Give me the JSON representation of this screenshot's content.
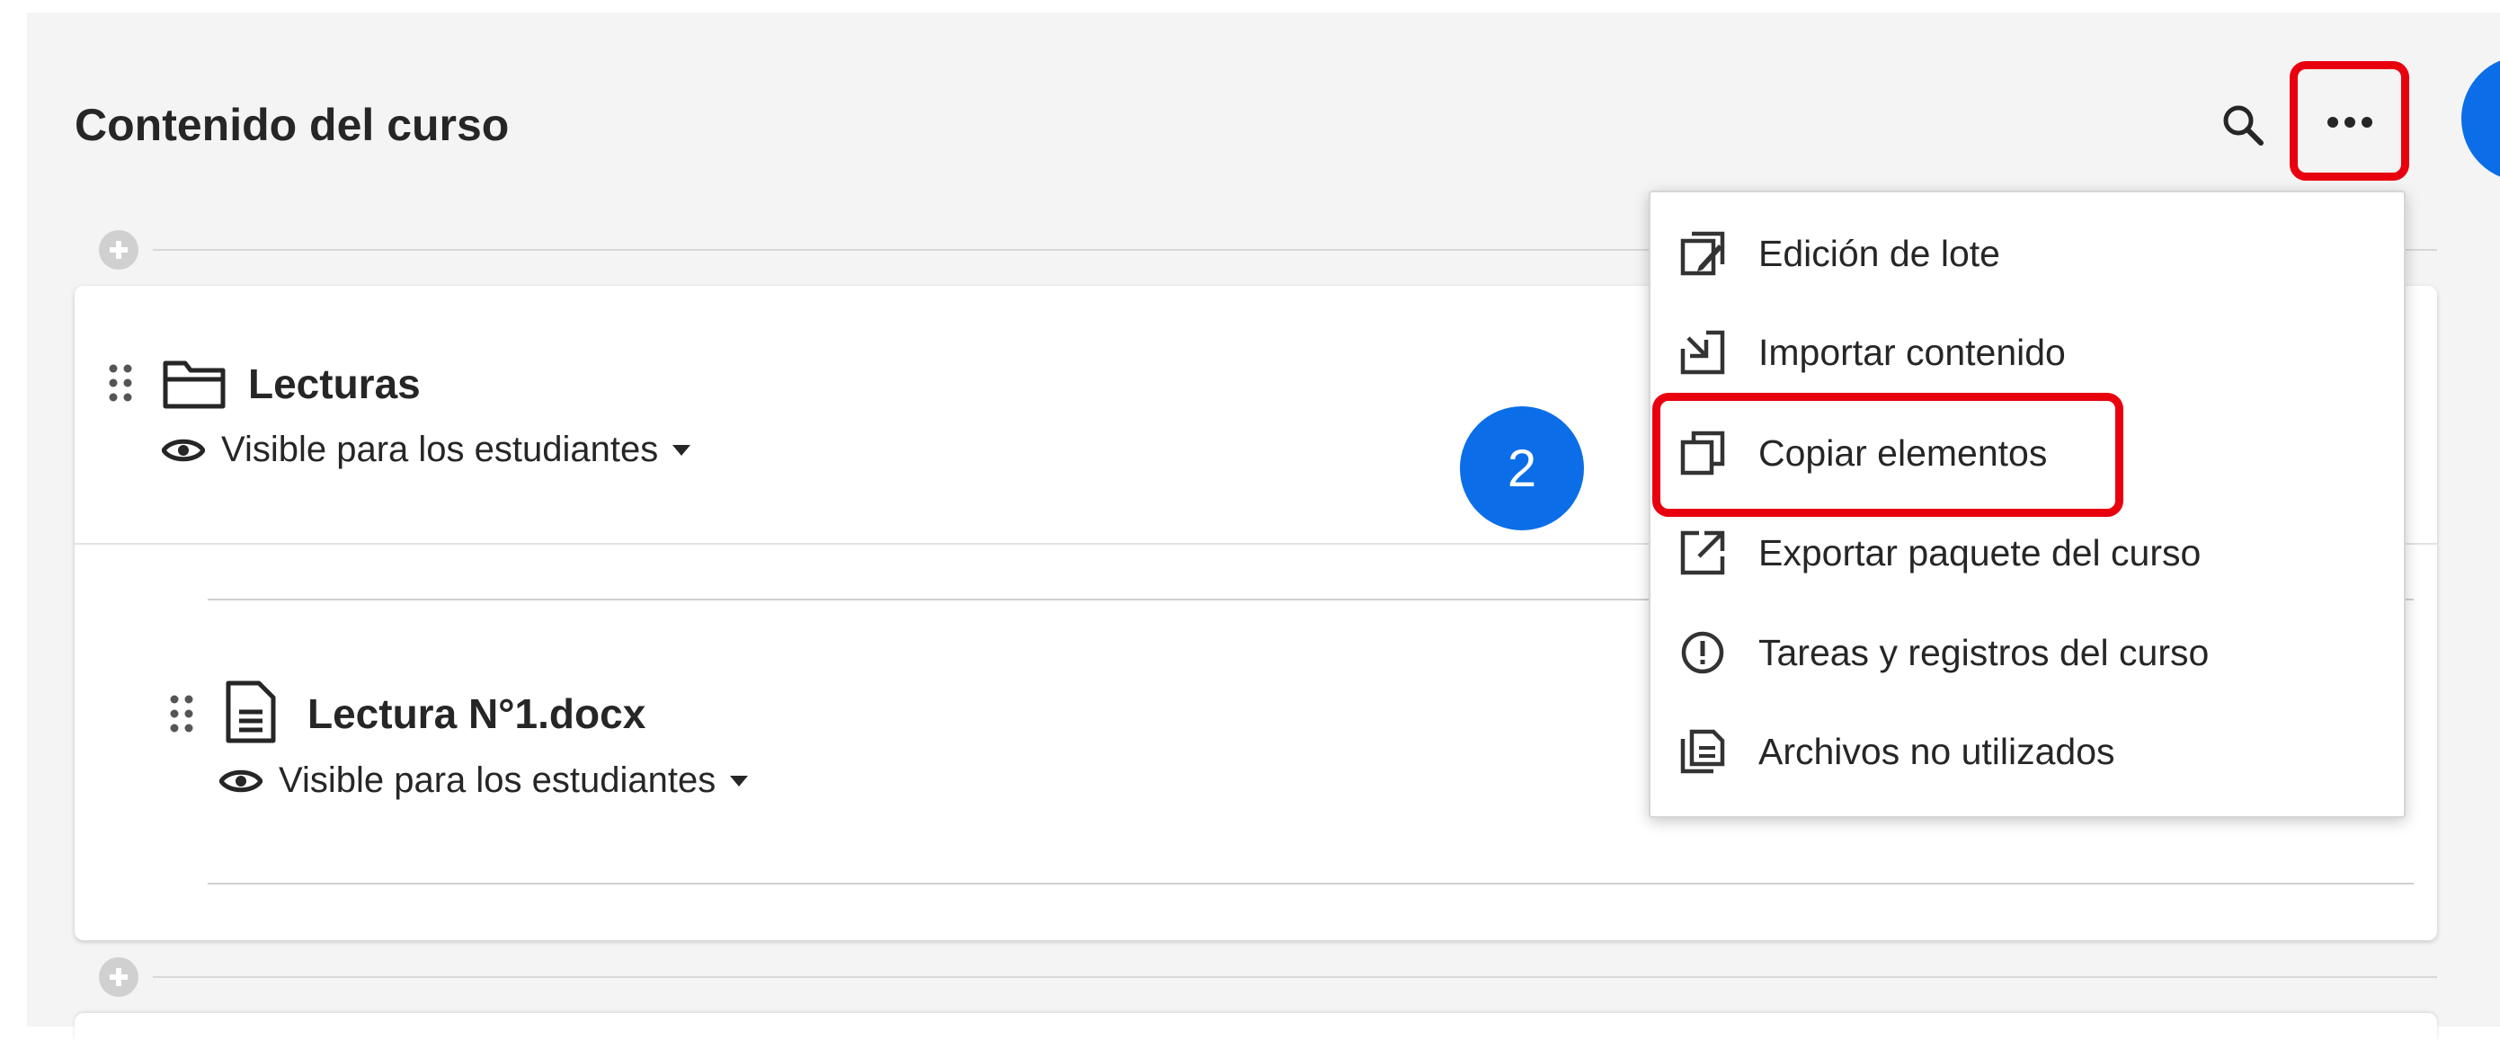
{
  "page": {
    "title": "Contenido del curso"
  },
  "toolbar": {
    "search_icon": "search-icon",
    "more_icon": "more-options-icon"
  },
  "steps": {
    "step1": "",
    "step2": "2"
  },
  "folder": {
    "title": "Lecturas",
    "visibility": "Visible para los estudiantes"
  },
  "document": {
    "title": "Lectura N°1.docx",
    "visibility": "Visible para los estudiantes"
  },
  "menu": {
    "items": [
      {
        "label": "Edición de lote",
        "icon": "batch-edit-icon"
      },
      {
        "label": "Importar contenido",
        "icon": "import-icon"
      },
      {
        "label": "Copiar elementos",
        "icon": "copy-icon"
      },
      {
        "label": "Exportar paquete del curso",
        "icon": "export-icon"
      },
      {
        "label": "Tareas y registros del curso",
        "icon": "alert-circle-icon"
      },
      {
        "label": "Archivos no utilizados",
        "icon": "files-icon"
      }
    ]
  },
  "colors": {
    "highlight": "#e8000e",
    "step_badge": "#0b6ee8",
    "background": "#f4f4f4"
  }
}
